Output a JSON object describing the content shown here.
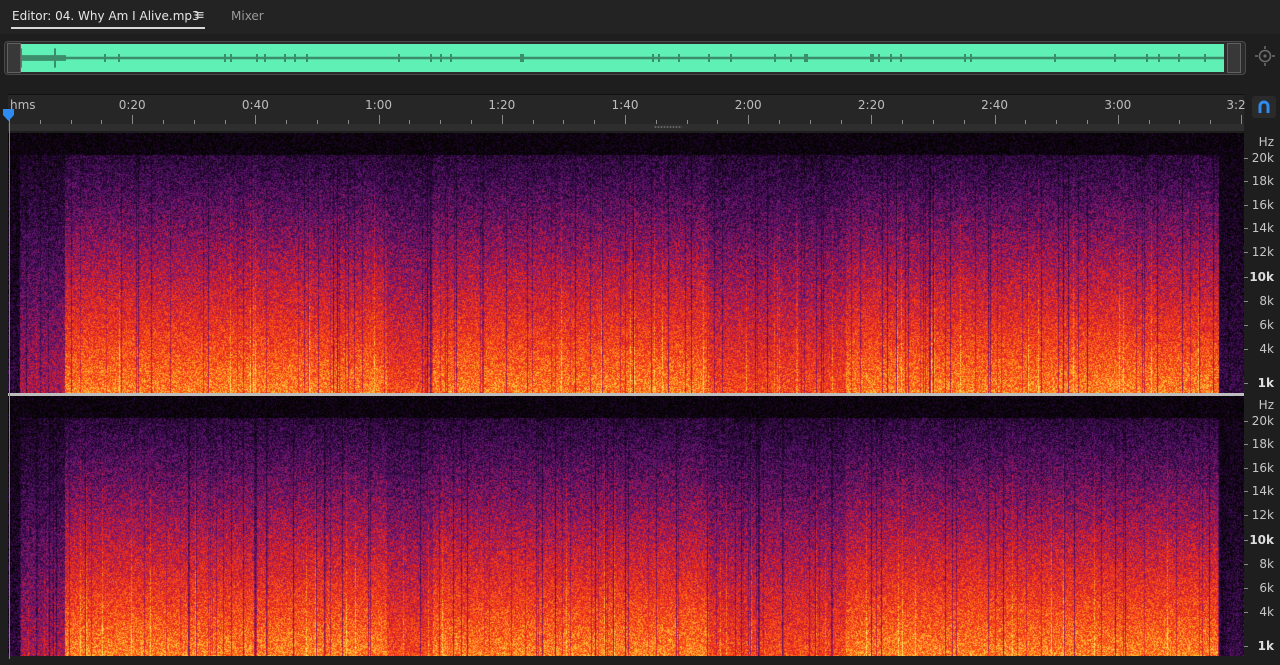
{
  "tabs": {
    "editor_label": "Editor: 04. Why Am I Alive.mp3",
    "menu_glyph": "≡",
    "mixer_label": "Mixer"
  },
  "overview": {
    "color": "#5ef0b4"
  },
  "ruler": {
    "unit_label": "hms",
    "labels": [
      "0:20",
      "0:40",
      "1:00",
      "1:20",
      "1:40",
      "2:00",
      "2:20",
      "2:40",
      "3:00",
      "3:2"
    ]
  },
  "freq_scale": {
    "unit": "Hz",
    "labels": [
      "20k",
      "18k",
      "16k",
      "14k",
      "12k",
      "10k",
      "8k",
      "6k",
      "4k",
      "1k"
    ],
    "bold": [
      "10k",
      "1k"
    ]
  },
  "icons": {
    "zoom": "zoom-to-fit-icon",
    "snap": "magnet-icon",
    "playhead": "playhead-marker-icon"
  },
  "colors": {
    "spectral_low": "#ffe36b",
    "spectral_mid": "#ff3a1a",
    "spectral_high": "#6a1a7a",
    "playhead": "#ff5a3c",
    "accent": "#2e8bf0"
  }
}
